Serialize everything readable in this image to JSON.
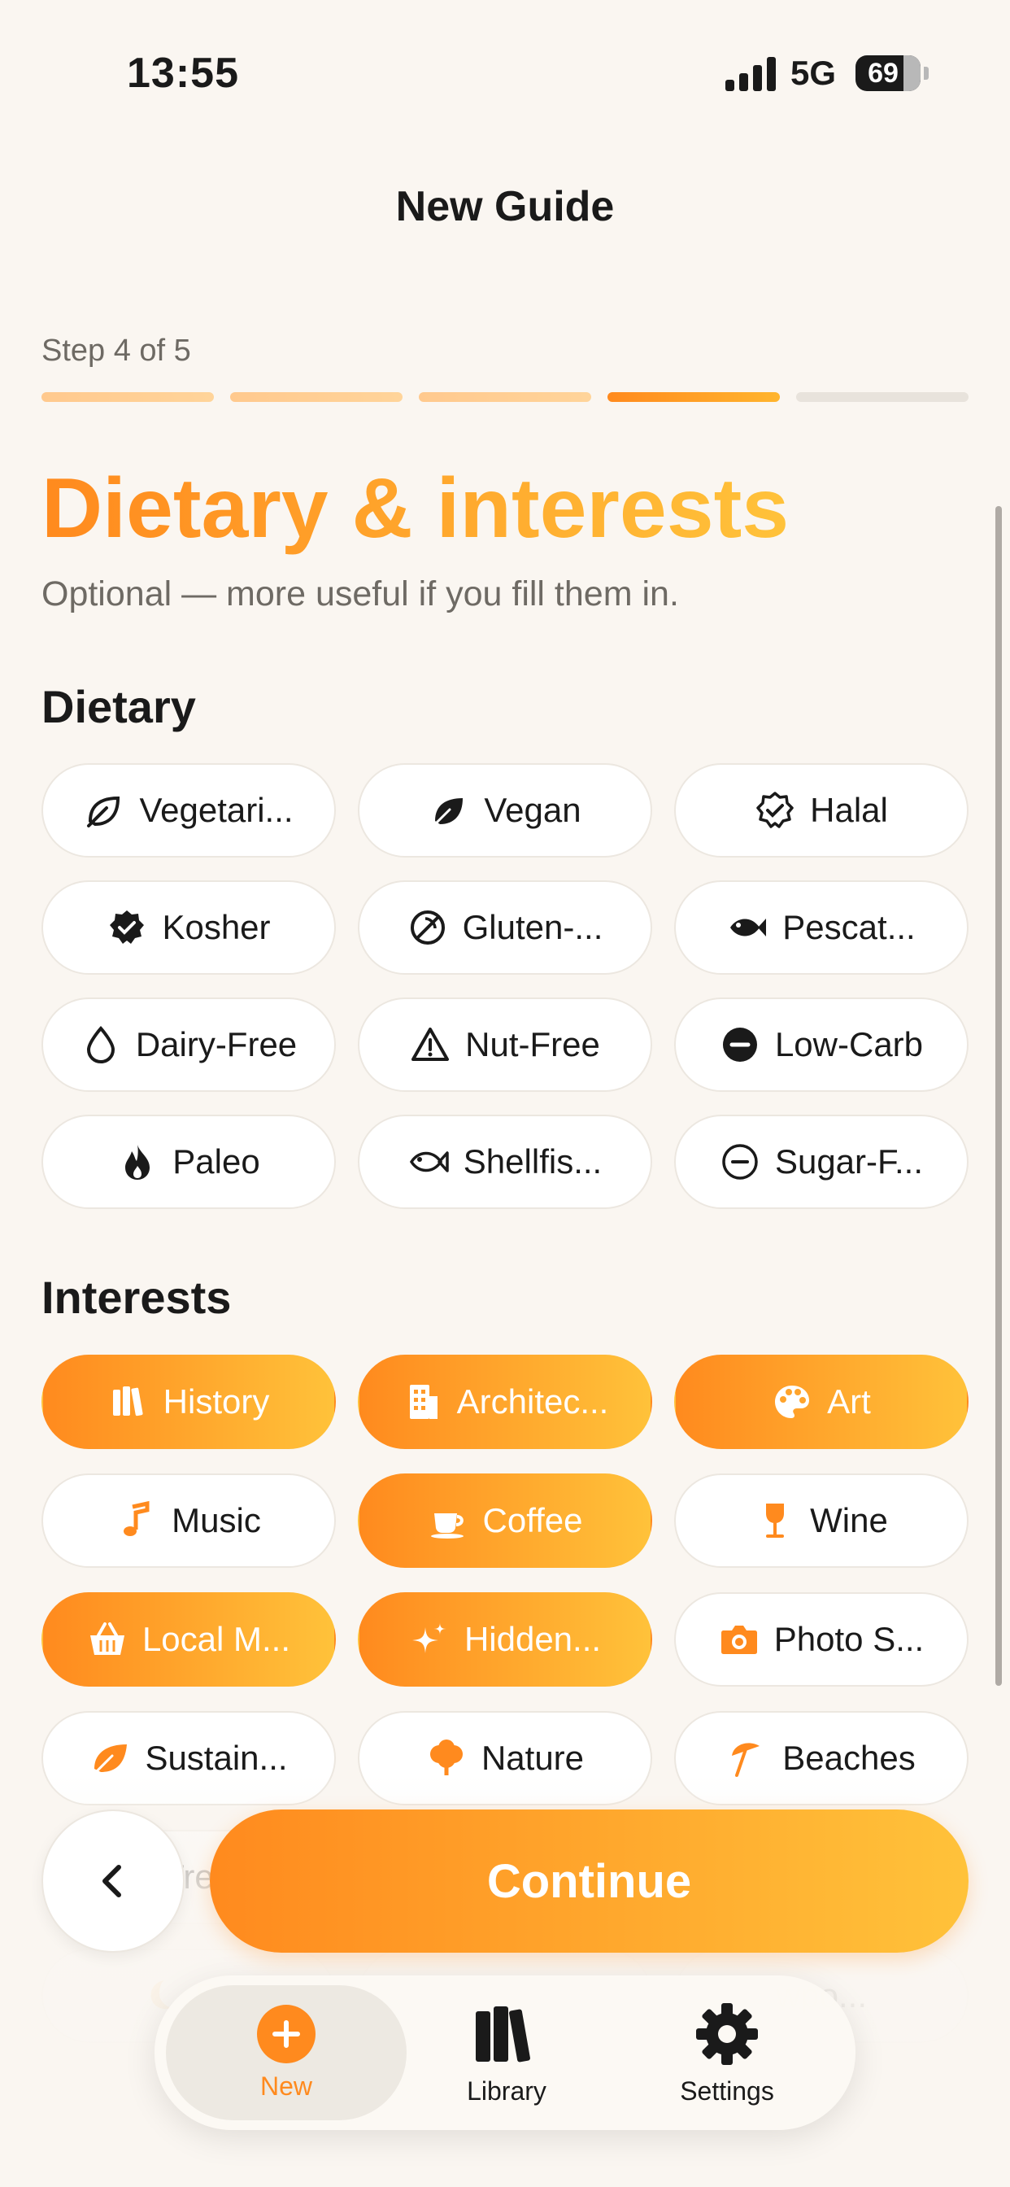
{
  "status": {
    "time": "13:55",
    "network": "5G",
    "battery": "69"
  },
  "nav": {
    "title": "New Guide"
  },
  "step": {
    "label": "Step 4 of 5",
    "current": 4,
    "total": 5
  },
  "heading": "Dietary & interests",
  "subheading": "Optional — more useful if you fill them in.",
  "dietary": {
    "title": "Dietary",
    "items": [
      {
        "label": "Vegetari...",
        "icon": "leaf-outline-icon",
        "selected": false
      },
      {
        "label": "Vegan",
        "icon": "leaf-filled-icon",
        "selected": false
      },
      {
        "label": "Halal",
        "icon": "check-seal-outline-icon",
        "selected": false
      },
      {
        "label": "Kosher",
        "icon": "check-seal-filled-icon",
        "selected": false
      },
      {
        "label": "Gluten-...",
        "icon": "no-wheat-icon",
        "selected": false
      },
      {
        "label": "Pescat...",
        "icon": "fish-filled-icon",
        "selected": false
      },
      {
        "label": "Dairy-Free",
        "icon": "drop-icon",
        "selected": false
      },
      {
        "label": "Nut-Free",
        "icon": "warning-triangle-icon",
        "selected": false
      },
      {
        "label": "Low-Carb",
        "icon": "minus-circle-filled-icon",
        "selected": false
      },
      {
        "label": "Paleo",
        "icon": "flame-icon",
        "selected": false
      },
      {
        "label": "Shellfis...",
        "icon": "fish-outline-icon",
        "selected": false
      },
      {
        "label": "Sugar-F...",
        "icon": "minus-circle-outline-icon",
        "selected": false
      }
    ]
  },
  "interests": {
    "title": "Interests",
    "items": [
      {
        "label": "History",
        "icon": "books-icon",
        "selected": true
      },
      {
        "label": "Architec...",
        "icon": "building-icon",
        "selected": true
      },
      {
        "label": "Art",
        "icon": "palette-icon",
        "selected": true
      },
      {
        "label": "Music",
        "icon": "music-note-icon",
        "selected": false
      },
      {
        "label": "Coffee",
        "icon": "coffee-cup-icon",
        "selected": true
      },
      {
        "label": "Wine",
        "icon": "wine-glass-icon",
        "selected": false
      },
      {
        "label": "Local M...",
        "icon": "basket-icon",
        "selected": true
      },
      {
        "label": "Hidden...",
        "icon": "sparkles-icon",
        "selected": true
      },
      {
        "label": "Photo S...",
        "icon": "camera-icon",
        "selected": false
      },
      {
        "label": "Sustain...",
        "icon": "leaf-orange-icon",
        "selected": false
      },
      {
        "label": "Nature",
        "icon": "tree-icon",
        "selected": false
      },
      {
        "label": "Beaches",
        "icon": "beach-umbrella-icon",
        "selected": false
      },
      {
        "label": "Tre",
        "icon": "none",
        "selected": false,
        "faded": true
      },
      {
        "label": "",
        "icon": "none",
        "selected": false,
        "faded": true
      },
      {
        "label": "",
        "icon": "none",
        "selected": false,
        "faded": true
      },
      {
        "label": "Ba",
        "icon": "moon-icon",
        "selected": false,
        "faded": true
      },
      {
        "label": "",
        "icon": "none",
        "selected": false,
        "faded": true
      },
      {
        "label": "wpo...",
        "icon": "none",
        "selected": false,
        "faded": true
      }
    ]
  },
  "actions": {
    "continue_label": "Continue"
  },
  "tabbar": {
    "tabs": [
      {
        "label": "New",
        "icon": "plus-circle-icon",
        "active": true
      },
      {
        "label": "Library",
        "icon": "books-icon",
        "active": false
      },
      {
        "label": "Settings",
        "icon": "gear-icon",
        "active": false
      }
    ]
  },
  "colors": {
    "accent": "#FF8A1E",
    "accent_end": "#FFC23A",
    "background": "#FAF6F1"
  }
}
